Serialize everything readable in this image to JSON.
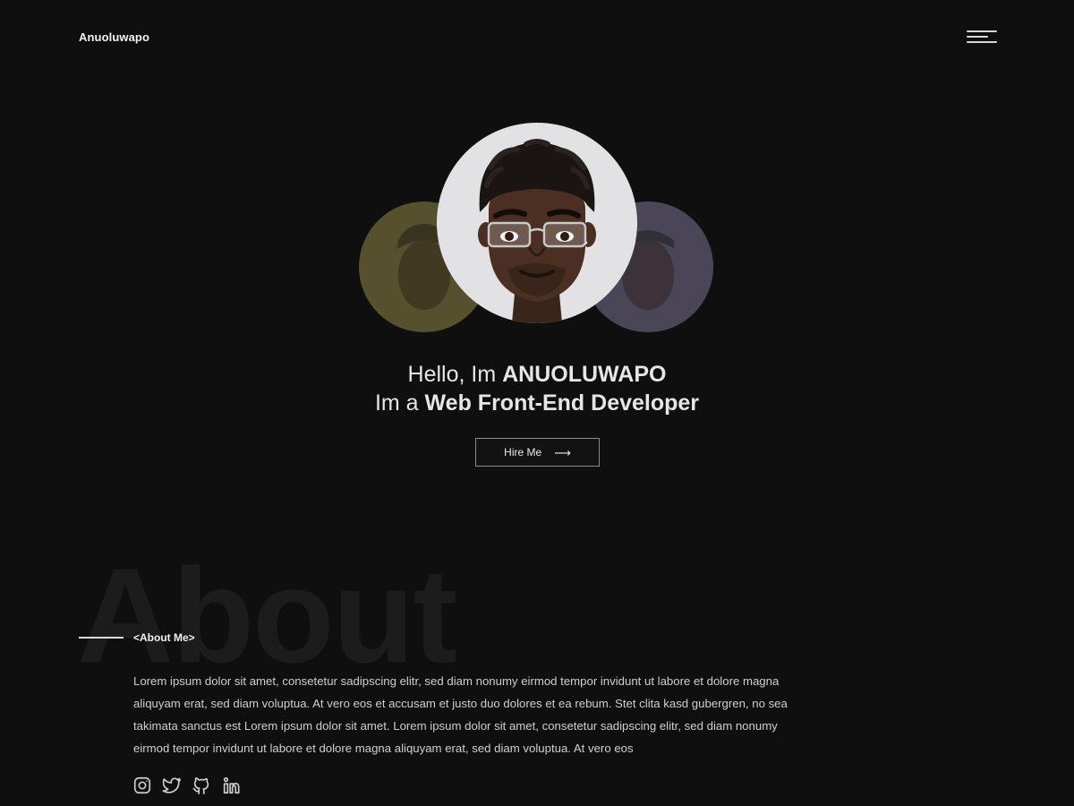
{
  "header": {
    "logo": "Anuoluwapo",
    "menu_icon": "hamburger-menu-icon"
  },
  "hero": {
    "greeting_prefix": "Hello, Im ",
    "name": "ANUOLUWAPO",
    "role_prefix": "Im a ",
    "role": "Web Front-End Developer",
    "hire_label": "Hire Me",
    "hire_icon": "arrow-right-icon"
  },
  "about": {
    "watermark": "About",
    "label": "<About Me>",
    "text": "Lorem ipsum dolor sit amet, consetetur sadipscing elitr, sed diam nonumy eirmod tempor invidunt ut labore et dolore magna aliquyam erat, sed diam voluptua. At vero eos et accusam et justo duo dolores et ea rebum. Stet clita kasd gubergren, no sea takimata sanctus est Lorem ipsum dolor sit amet. Lorem ipsum dolor sit amet, consetetur sadipscing elitr, sed diam nonumy eirmod tempor invidunt ut labore et dolore magna aliquyam erat, sed diam voluptua. At vero eos"
  },
  "socials": [
    {
      "icon": "instagram-icon"
    },
    {
      "icon": "twitter-icon"
    },
    {
      "icon": "github-icon"
    },
    {
      "icon": "linkedin-icon"
    }
  ],
  "colors": {
    "background": "#0f0f0f",
    "text": "#e8e8e8",
    "avatar_left_bg": "#57502f",
    "avatar_right_bg": "#4a4658",
    "avatar_main_bg": "#e2e2e4"
  }
}
